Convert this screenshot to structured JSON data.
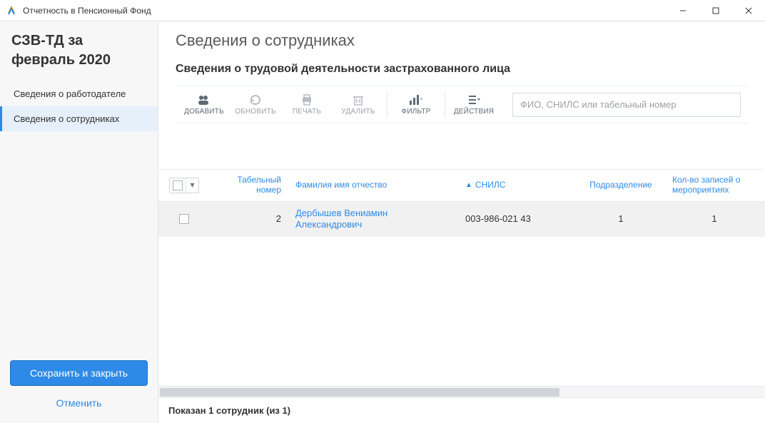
{
  "window": {
    "title": "Отчетность в Пенсионный Фонд"
  },
  "sidebar": {
    "form_title": "СЗВ-ТД за февраль 2020",
    "items": [
      {
        "label": "Сведения о работодателе",
        "active": false
      },
      {
        "label": "Сведения о сотрудниках",
        "active": true
      }
    ],
    "save_label": "Сохранить и закрыть",
    "cancel_label": "Отменить"
  },
  "page": {
    "title": "Сведения о сотрудниках",
    "subtitle": "Сведения о трудовой деятельности застрахованного лица"
  },
  "toolbar": {
    "add": "ДОБАВИТЬ",
    "refresh": "ОБНОВИТЬ",
    "print": "ПЕЧАТЬ",
    "delete": "УДАЛИТЬ",
    "filter": "ФИЛЬТР",
    "actions": "ДЕЙСТВИЯ",
    "search_placeholder": "ФИО, СНИЛС или табельный номер"
  },
  "table": {
    "columns": {
      "tabnum": "Табельный номер",
      "fio": "Фамилия имя отчество",
      "snils": "СНИЛС",
      "department": "Подразделение",
      "records": "Кол-во записей о мероприятиях"
    },
    "rows": [
      {
        "tabnum": "2",
        "fio": "Дербышев Вениамин Александрович",
        "snils": "003-986-021 43",
        "department": "1",
        "records": "1"
      }
    ]
  },
  "footer": {
    "summary": "Показан 1 сотрудник (из 1)"
  }
}
